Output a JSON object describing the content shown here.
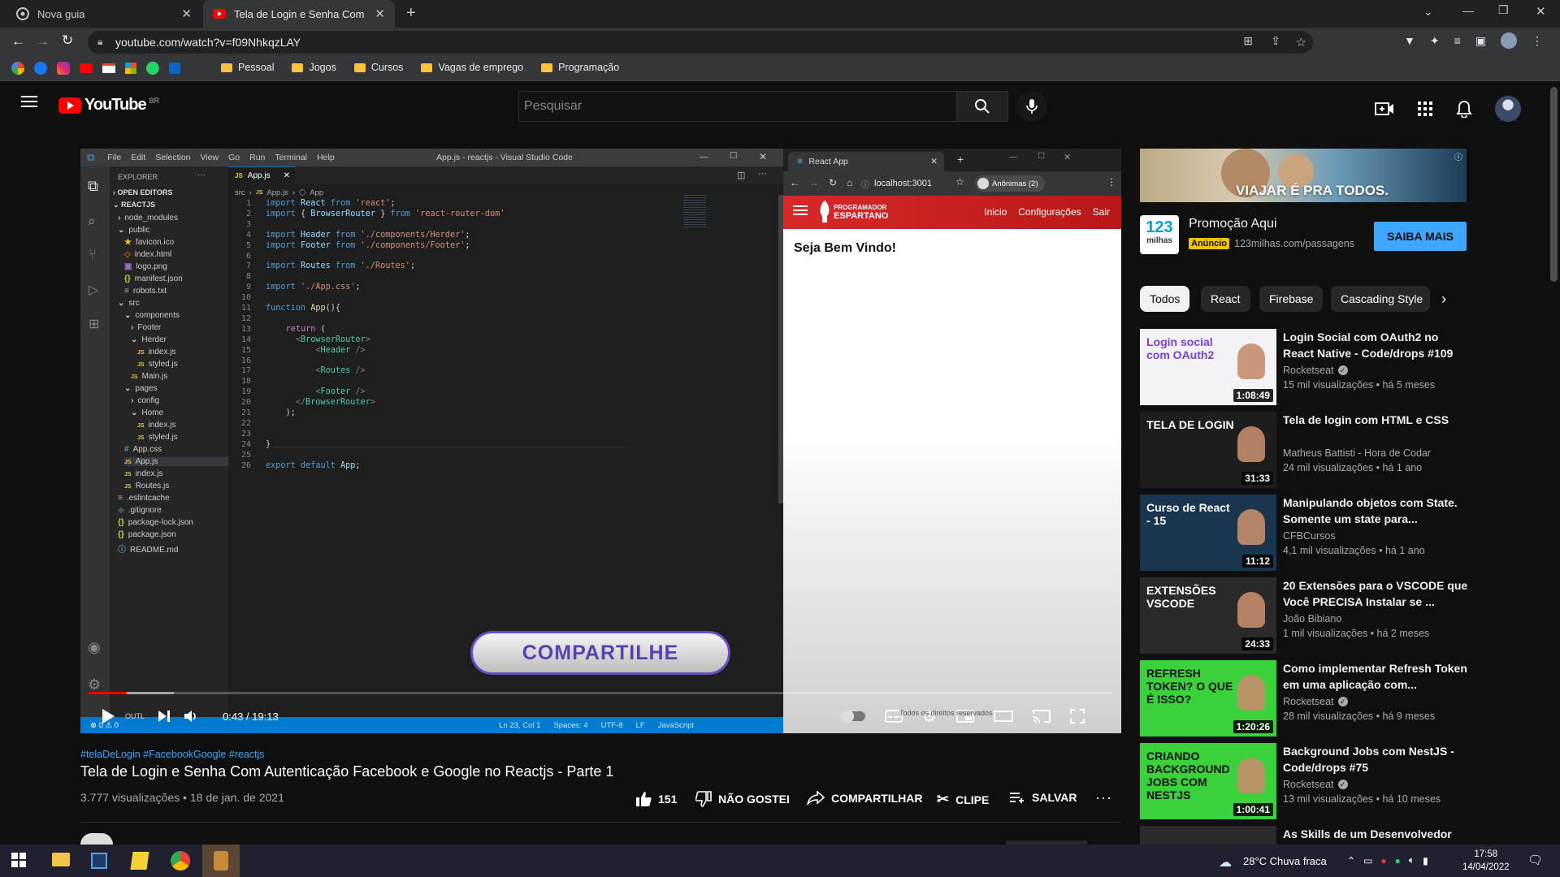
{
  "browser": {
    "tabs": [
      {
        "label": "Nova guia"
      },
      {
        "label": "Tela de Login e Senha Com Autent"
      }
    ],
    "url": "youtube.com/watch?v=f09NhkqzLAY",
    "bookmarks": [
      "Pessoal",
      "Jogos",
      "Cursos",
      "Vagas de emprego",
      "Programação"
    ]
  },
  "youtube": {
    "logo_text": "YouTube",
    "country": "BR",
    "search_placeholder": "Pesquisar"
  },
  "vscode": {
    "menu": [
      "File",
      "Edit",
      "Selection",
      "View",
      "Go",
      "Run",
      "Terminal",
      "Help"
    ],
    "window_title": "App.js - reactjs - Visual Studio Code",
    "explorer_title": "EXPLORER",
    "open_editors": "OPEN EDITORS",
    "project": "REACTJS",
    "tab": "App.js",
    "breadcrumb": [
      "src",
      "App.js",
      "App"
    ],
    "tree": [
      {
        "label": "node_modules",
        "indent": 1,
        "type": "folder"
      },
      {
        "label": "public",
        "indent": 1,
        "type": "folder-open"
      },
      {
        "label": "favicon.ico",
        "indent": 2,
        "type": "star"
      },
      {
        "label": "index.html",
        "indent": 2,
        "type": "html"
      },
      {
        "label": "logo.png",
        "indent": 2,
        "type": "img"
      },
      {
        "label": "manifest.json",
        "indent": 2,
        "type": "json"
      },
      {
        "label": "robots.txt",
        "indent": 2,
        "type": "txt"
      },
      {
        "label": "src",
        "indent": 1,
        "type": "folder-open"
      },
      {
        "label": "components",
        "indent": 2,
        "type": "folder-open"
      },
      {
        "label": "Footer",
        "indent": 3,
        "type": "folder"
      },
      {
        "label": "Herder",
        "indent": 3,
        "type": "folder-open"
      },
      {
        "label": "index.js",
        "indent": 4,
        "type": "js"
      },
      {
        "label": "styled.js",
        "indent": 4,
        "type": "js"
      },
      {
        "label": "Main.js",
        "indent": 3,
        "type": "js"
      },
      {
        "label": "pages",
        "indent": 2,
        "type": "folder-open"
      },
      {
        "label": "config",
        "indent": 3,
        "type": "folder"
      },
      {
        "label": "Home",
        "indent": 3,
        "type": "folder-open"
      },
      {
        "label": "index.js",
        "indent": 4,
        "type": "js"
      },
      {
        "label": "styled.js",
        "indent": 4,
        "type": "js"
      },
      {
        "label": "App.css",
        "indent": 2,
        "type": "css"
      },
      {
        "label": "App.js",
        "indent": 2,
        "type": "js"
      },
      {
        "label": "index.js",
        "indent": 2,
        "type": "js"
      },
      {
        "label": "Routes.js",
        "indent": 2,
        "type": "js"
      },
      {
        "label": ".eslintcache",
        "indent": 1,
        "type": "txt"
      },
      {
        "label": ".gitignore",
        "indent": 1,
        "type": "git"
      },
      {
        "label": "package-lock.json",
        "indent": 1,
        "type": "json"
      },
      {
        "label": "package.json",
        "indent": 1,
        "type": "json"
      },
      {
        "label": "README.md",
        "indent": 1,
        "type": "info"
      }
    ],
    "code": [
      [
        [
          "kw",
          "import "
        ],
        [
          "vr",
          "React "
        ],
        [
          "kw",
          "from "
        ],
        [
          "st",
          "'react'"
        ],
        [
          "pl",
          ";"
        ]
      ],
      [
        [
          "kw",
          "import "
        ],
        [
          "pl",
          "{ "
        ],
        [
          "vr",
          "BrowserRouter "
        ],
        [
          "pl",
          "} "
        ],
        [
          "kw",
          "from "
        ],
        [
          "st",
          "'react-router-dom'"
        ]
      ],
      [],
      [
        [
          "kw",
          "import "
        ],
        [
          "vr",
          "Header "
        ],
        [
          "kw",
          "from "
        ],
        [
          "st",
          "'./components/Herder'"
        ],
        [
          "pl",
          ";"
        ]
      ],
      [
        [
          "kw",
          "import "
        ],
        [
          "vr",
          "Footer "
        ],
        [
          "kw",
          "from "
        ],
        [
          "st",
          "'./components/Footer'"
        ],
        [
          "pl",
          ";"
        ]
      ],
      [],
      [
        [
          "kw",
          "import "
        ],
        [
          "vr",
          "Routes "
        ],
        [
          "kw",
          "from "
        ],
        [
          "st",
          "'./Routes'"
        ],
        [
          "pl",
          ";"
        ]
      ],
      [],
      [
        [
          "kw",
          "import "
        ],
        [
          "st",
          "'./App.css'"
        ],
        [
          "pl",
          ";"
        ]
      ],
      [],
      [
        [
          "kw",
          "function "
        ],
        [
          "fn",
          "App"
        ],
        [
          "pl",
          "(){"
        ]
      ],
      [],
      [
        [
          "pl",
          "    "
        ],
        [
          "pp",
          "return "
        ],
        [
          "pl",
          "("
        ]
      ],
      [
        [
          "pl",
          "      "
        ],
        [
          "grey",
          "<"
        ],
        [
          "tg",
          "BrowserRouter"
        ],
        [
          "grey",
          ">"
        ]
      ],
      [
        [
          "pl",
          "          "
        ],
        [
          "grey",
          "<"
        ],
        [
          "tg",
          "Header "
        ],
        [
          "grey",
          "/>"
        ]
      ],
      [],
      [
        [
          "pl",
          "          "
        ],
        [
          "grey",
          "<"
        ],
        [
          "tg",
          "Routes "
        ],
        [
          "grey",
          "/>"
        ]
      ],
      [],
      [
        [
          "pl",
          "          "
        ],
        [
          "grey",
          "<"
        ],
        [
          "tg",
          "Footer "
        ],
        [
          "grey",
          "/>"
        ]
      ],
      [
        [
          "pl",
          "      "
        ],
        [
          "grey",
          "</"
        ],
        [
          "tg",
          "BrowserRouter"
        ],
        [
          "grey",
          ">"
        ]
      ],
      [
        [
          "pl",
          "    );"
        ]
      ],
      [],
      [],
      [
        [
          "pl",
          "}"
        ]
      ],
      [],
      [
        [
          "kw",
          "export default "
        ],
        [
          "vr",
          "App"
        ],
        [
          "pl",
          ";"
        ]
      ]
    ],
    "status": [
      "Ln 23, Col 1",
      "Spaces: 4",
      "UTF-8",
      "LF",
      "JavaScript"
    ],
    "status_left": "⊗ 0 ⚠ 0"
  },
  "inner_browser": {
    "tab": "React App",
    "url": "localhost:3001",
    "profile": "Anônimas (2)",
    "brand_top": "PROGRAMADOR",
    "brand_bottom": "ESPARTANO",
    "nav": [
      "Inicio",
      "Configurações",
      "Sair"
    ],
    "welcome": "Seja Bem Vindo!"
  },
  "player": {
    "overlay_button": "COMPARTILHE",
    "time": "0:43 / 19:13",
    "progress": 0.037,
    "buffered": 0.083,
    "out_label": "OUTL",
    "caption_fragment": "Todos os direitos reservados"
  },
  "video": {
    "hashtags": "#telaDeLogin #FacebookGoogle #reactjs",
    "title": "Tela de Login e Senha Com Autenticação Facebook e Google no Reactjs - Parte 1",
    "meta": "3.777 visualizações • 18 de jan. de 2021",
    "likes": "151",
    "dislike": "NÃO GOSTEI",
    "share": "COMPARTILHAR",
    "clip": "CLIPE",
    "save": "SALVAR"
  },
  "ad": {
    "banner_text": "VIAJAR É PRA TODOS.",
    "logo_top": "123",
    "logo_bottom": "milhas",
    "title": "Promoção Aqui",
    "badge": "Anúncio",
    "domain": "123milhas.com/passagens",
    "cta": "SAIBA MAIS"
  },
  "chips": [
    "Todos",
    "React",
    "Firebase",
    "Cascading Style"
  ],
  "recommendations": [
    {
      "title": "Login Social com OAuth2 no React Native - Code/drops #109",
      "channel": "Rocketseat",
      "verified": true,
      "meta": "15 mil visualizações • há 5 meses",
      "duration": "1:08:49",
      "thumb_text": "Login social com OAuth2",
      "thumb_bg": "#f2f2f7",
      "thumb_fg": "#7a3fd1"
    },
    {
      "title": "Tela de login com HTML e CSS",
      "channel": "Matheus Battisti - Hora de Codar",
      "verified": false,
      "meta": "24 mil visualizações • há 1 ano",
      "duration": "31:33",
      "thumb_text": "TELA DE LOGIN",
      "thumb_bg": "#1d1d1d",
      "thumb_fg": "#ffffff"
    },
    {
      "title": "Manipulando objetos com State. Somente um state para...",
      "channel": "CFBCursos",
      "verified": false,
      "meta": "4,1 mil visualizações • há 1 ano",
      "duration": "11:12",
      "thumb_text": "Curso de React - 15",
      "thumb_bg": "#1a3550",
      "thumb_fg": "#ffffff"
    },
    {
      "title": "20 Extensões para o VSCODE que Você PRECISA Instalar se ...",
      "channel": "João Bibiano",
      "verified": false,
      "meta": "1 mil visualizações • há 2 meses",
      "duration": "24:33",
      "thumb_text": "EXTENSÕES VSCODE",
      "thumb_bg": "#2a2a2a",
      "thumb_fg": "#ffffff"
    },
    {
      "title": "Como implementar Refresh Token em uma aplicação com...",
      "channel": "Rocketseat",
      "verified": true,
      "meta": "28 mil visualizações • há 9 meses",
      "duration": "1:20:26",
      "thumb_text": "REFRESH TOKEN? O QUE É ISSO?",
      "thumb_bg": "#3ad13a",
      "thumb_fg": "#111111"
    },
    {
      "title": "Background Jobs com NestJS - Code/drops #75",
      "channel": "Rocketseat",
      "verified": true,
      "meta": "13 mil visualizações • há 10 meses",
      "duration": "1:00:41",
      "thumb_text": "CRIANDO BACKGROUND JOBS COM NESTJS",
      "thumb_bg": "#3ad13a",
      "thumb_fg": "#111111"
    },
    {
      "title": "As Skills de um Desenvolvedor",
      "channel": "",
      "verified": false,
      "meta": "",
      "duration": "",
      "thumb_text": "",
      "thumb_bg": "#2b2b2b",
      "thumb_fg": "#ffffff"
    }
  ],
  "taskbar": {
    "weather": "28°C  Chuva fraca",
    "time": "17:58",
    "date": "14/04/2022"
  },
  "colors": {
    "youtube_red": "#ff0000",
    "link_blue": "#3ea6ff",
    "vscode_blue": "#007acc",
    "nav_red": "#c92020"
  }
}
